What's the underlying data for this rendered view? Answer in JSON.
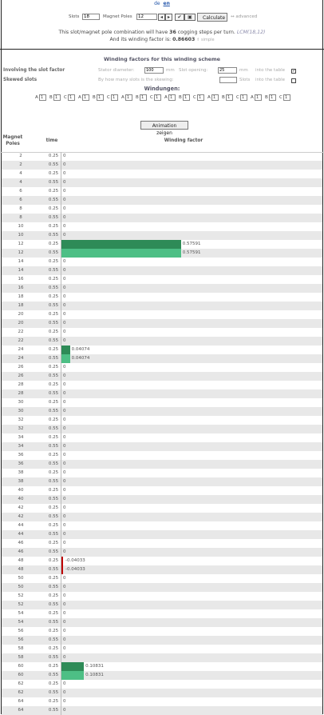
{
  "lang": {
    "de": "de",
    "en": "en"
  },
  "form": {
    "slots_label": "Slots",
    "slots_value": "18",
    "poles_label": "Magnet Poles",
    "poles_value": "12",
    "calculate": "Calculate",
    "advanced": "↔ advanced"
  },
  "info": {
    "line1_pre": "This slot/magnet pole combination will have",
    "cogging_steps": "36",
    "line1_post": "cogging steps per turn.",
    "lcm": "LCM(18,12)",
    "line2_pre": "And its winding factor is:",
    "winding_factor": "0.86603",
    "simple": "⇑ simple"
  },
  "winding_factors": {
    "title": "Winding factors for this winding scheme",
    "slot_factor_label": "Involving the slot factor",
    "stator_diameter_label": "Stator diameter:",
    "stator_diameter_value": "100",
    "mm1": "mm",
    "slot_opening_label": "Slot opening:",
    "slot_opening_value": "25",
    "mm2": "mm",
    "into_table1": "into the table",
    "into_table1_checked": true,
    "skewed_label": "Skewed slots",
    "skew_desc": "By how many slots is the skewing:",
    "skew_value": "",
    "slots_unit": "Slots",
    "into_table2": "into the table",
    "into_table2_checked": false
  },
  "windungen": {
    "title": "Windungen:",
    "phases": [
      {
        "p": "A",
        "v": "1"
      },
      {
        "p": "B",
        "v": "1"
      },
      {
        "p": "C",
        "v": "1"
      },
      {
        "p": "A",
        "v": "1"
      },
      {
        "p": "B",
        "v": "1"
      },
      {
        "p": "C",
        "v": "1"
      },
      {
        "p": "A",
        "v": "1"
      },
      {
        "p": "B",
        "v": "1"
      },
      {
        "p": "C",
        "v": "1"
      },
      {
        "p": "A",
        "v": "1"
      },
      {
        "p": "B",
        "v": "1"
      },
      {
        "p": "C",
        "v": "1"
      },
      {
        "p": "A",
        "v": "1"
      },
      {
        "p": "B",
        "v": "1"
      },
      {
        "p": "C",
        "v": "1"
      },
      {
        "p": "A",
        "v": "1"
      },
      {
        "p": "B",
        "v": "1"
      },
      {
        "p": "C",
        "v": "1"
      }
    ]
  },
  "animation_button": "Animation zeigen",
  "table": {
    "col_poles": "Magnet Poles",
    "col_time": "time",
    "col_wf": "Winding factor",
    "rows": [
      {
        "poles": "2",
        "time": "0.25",
        "value": "0"
      },
      {
        "poles": "2",
        "time": "0.55",
        "value": "0"
      },
      {
        "poles": "4",
        "time": "0.25",
        "value": "0"
      },
      {
        "poles": "4",
        "time": "0.55",
        "value": "0"
      },
      {
        "poles": "6",
        "time": "0.25",
        "value": "0"
      },
      {
        "poles": "6",
        "time": "0.55",
        "value": "0"
      },
      {
        "poles": "8",
        "time": "0.25",
        "value": "0"
      },
      {
        "poles": "8",
        "time": "0.55",
        "value": "0"
      },
      {
        "poles": "10",
        "time": "0.25",
        "value": "0"
      },
      {
        "poles": "10",
        "time": "0.55",
        "value": "0"
      },
      {
        "poles": "12",
        "time": "0.25",
        "value": "0.57591"
      },
      {
        "poles": "12",
        "time": "0.55",
        "value": "0.57591"
      },
      {
        "poles": "14",
        "time": "0.25",
        "value": "0"
      },
      {
        "poles": "14",
        "time": "0.55",
        "value": "0"
      },
      {
        "poles": "16",
        "time": "0.25",
        "value": "0"
      },
      {
        "poles": "16",
        "time": "0.55",
        "value": "0"
      },
      {
        "poles": "18",
        "time": "0.25",
        "value": "0"
      },
      {
        "poles": "18",
        "time": "0.55",
        "value": "0"
      },
      {
        "poles": "20",
        "time": "0.25",
        "value": "0"
      },
      {
        "poles": "20",
        "time": "0.55",
        "value": "0"
      },
      {
        "poles": "22",
        "time": "0.25",
        "value": "0"
      },
      {
        "poles": "22",
        "time": "0.55",
        "value": "0"
      },
      {
        "poles": "24",
        "time": "0.25",
        "value": "0.04074"
      },
      {
        "poles": "24",
        "time": "0.55",
        "value": "0.04074"
      },
      {
        "poles": "26",
        "time": "0.25",
        "value": "0"
      },
      {
        "poles": "26",
        "time": "0.55",
        "value": "0"
      },
      {
        "poles": "28",
        "time": "0.25",
        "value": "0"
      },
      {
        "poles": "28",
        "time": "0.55",
        "value": "0"
      },
      {
        "poles": "30",
        "time": "0.25",
        "value": "0"
      },
      {
        "poles": "30",
        "time": "0.55",
        "value": "0"
      },
      {
        "poles": "32",
        "time": "0.25",
        "value": "0"
      },
      {
        "poles": "32",
        "time": "0.55",
        "value": "0"
      },
      {
        "poles": "34",
        "time": "0.25",
        "value": "0"
      },
      {
        "poles": "34",
        "time": "0.55",
        "value": "0"
      },
      {
        "poles": "36",
        "time": "0.25",
        "value": "0"
      },
      {
        "poles": "36",
        "time": "0.55",
        "value": "0"
      },
      {
        "poles": "38",
        "time": "0.25",
        "value": "0"
      },
      {
        "poles": "38",
        "time": "0.55",
        "value": "0"
      },
      {
        "poles": "40",
        "time": "0.25",
        "value": "0"
      },
      {
        "poles": "40",
        "time": "0.55",
        "value": "0"
      },
      {
        "poles": "42",
        "time": "0.25",
        "value": "0"
      },
      {
        "poles": "42",
        "time": "0.55",
        "value": "0"
      },
      {
        "poles": "44",
        "time": "0.25",
        "value": "0"
      },
      {
        "poles": "44",
        "time": "0.55",
        "value": "0"
      },
      {
        "poles": "46",
        "time": "0.25",
        "value": "0"
      },
      {
        "poles": "46",
        "time": "0.55",
        "value": "0"
      },
      {
        "poles": "48",
        "time": "0.25",
        "value": "-0.04033"
      },
      {
        "poles": "48",
        "time": "0.55",
        "value": "-0.04033"
      },
      {
        "poles": "50",
        "time": "0.25",
        "value": "0"
      },
      {
        "poles": "50",
        "time": "0.55",
        "value": "0"
      },
      {
        "poles": "52",
        "time": "0.25",
        "value": "0"
      },
      {
        "poles": "52",
        "time": "0.55",
        "value": "0"
      },
      {
        "poles": "54",
        "time": "0.25",
        "value": "0"
      },
      {
        "poles": "54",
        "time": "0.55",
        "value": "0"
      },
      {
        "poles": "56",
        "time": "0.25",
        "value": "0"
      },
      {
        "poles": "56",
        "time": "0.55",
        "value": "0"
      },
      {
        "poles": "58",
        "time": "0.25",
        "value": "0"
      },
      {
        "poles": "58",
        "time": "0.55",
        "value": "0"
      },
      {
        "poles": "60",
        "time": "0.25",
        "value": "0.10831"
      },
      {
        "poles": "60",
        "time": "0.55",
        "value": "0.10831"
      },
      {
        "poles": "62",
        "time": "0.25",
        "value": "0"
      },
      {
        "poles": "62",
        "time": "0.55",
        "value": "0"
      },
      {
        "poles": "64",
        "time": "0.25",
        "value": "0"
      },
      {
        "poles": "64",
        "time": "0.55",
        "value": "0"
      }
    ]
  },
  "colors": {
    "bar_first": "#2e8b57",
    "bar_second": "#4dbf85",
    "bar_negative": "#c00000",
    "row_alt": "#e8e8e8"
  }
}
